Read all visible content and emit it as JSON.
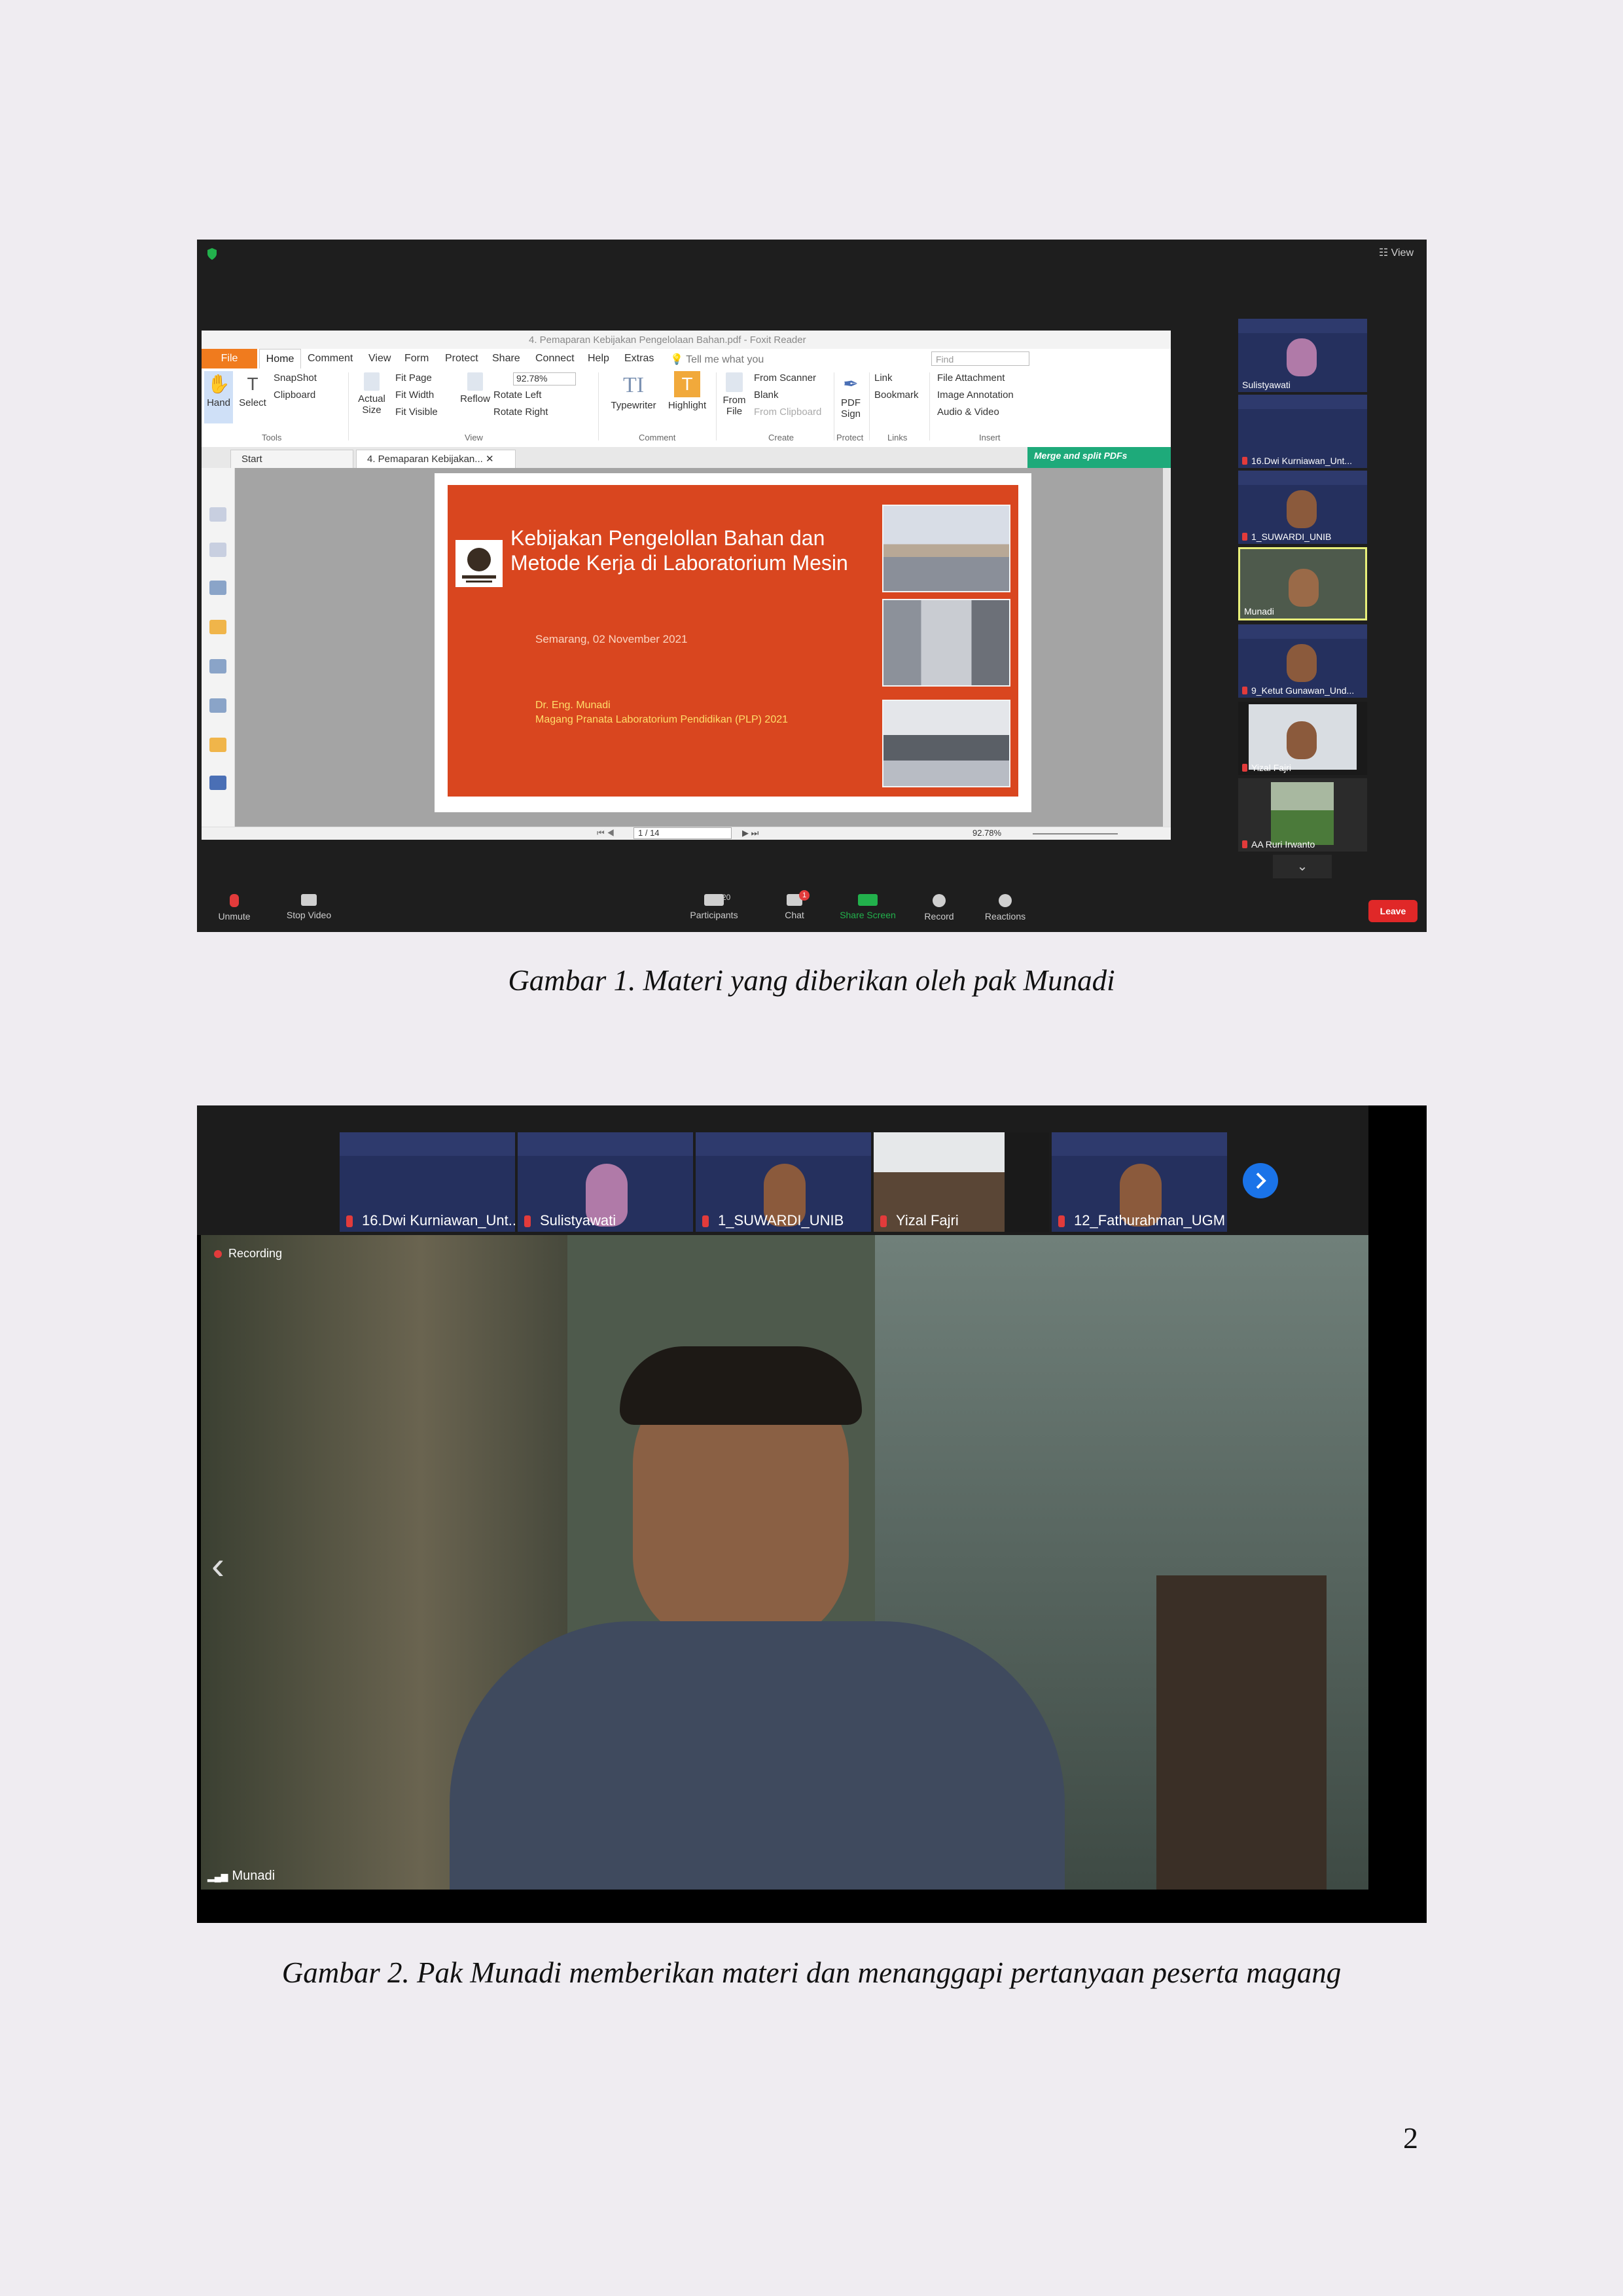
{
  "figure1": {
    "top_right_label": "View",
    "foxit": {
      "window_title": "4. Pemaparan Kebijakan Pengelolaan Bahan.pdf - Foxit Reader",
      "menu": [
        "File",
        "Home",
        "Comment",
        "View",
        "Form",
        "Protect",
        "Share",
        "Connect",
        "Help",
        "Extras"
      ],
      "tell_me": "Tell me what you",
      "find_placeholder": "Find",
      "ribbon": {
        "hand": "Hand",
        "select": "Select",
        "snapshot": "SnapShot",
        "clipboard": "Clipboard",
        "actual_size": "Actual Size",
        "fit_page": "Fit Page",
        "fit_width": "Fit Width",
        "fit_visible": "Fit Visible",
        "reflow": "Reflow",
        "zoom": "92.78%",
        "rotate_left": "Rotate Left",
        "rotate_right": "Rotate Right",
        "typewriter": "Typewriter",
        "highlight": "Highlight",
        "from_file": "From File",
        "from_scanner": "From Scanner",
        "blank": "Blank",
        "from_clipboard": "From Clipboard",
        "pdf_sign": "PDF Sign",
        "link": "Link",
        "bookmark": "Bookmark",
        "file_attachment": "File Attachment",
        "image_annotation": "Image Annotation",
        "audio_video": "Audio & Video",
        "groups": [
          "Tools",
          "View",
          "Comment",
          "Create",
          "Protect",
          "Links",
          "Insert"
        ]
      },
      "tabs": [
        "Start",
        "4. Pemaparan Kebijakan..."
      ],
      "merge_banner": "Merge and split PDFs",
      "slide": {
        "title_line1": "Kebijakan Pengelollan Bahan dan",
        "title_line2": "Metode Kerja di Laboratorium Mesin",
        "date": "Semarang, 02 November 2021",
        "author": "Dr. Eng. Munadi",
        "role": "Magang Pranata Laboratorium Pendidikan (PLP) 2021"
      },
      "status": {
        "page": "1 / 14",
        "zoom": "92.78%"
      }
    },
    "participants": [
      "Sulistyawati",
      "16.Dwi Kurniawan_Unt...",
      "1_SUWARDI_UNIB",
      "Munadi",
      "9_Ketut Gunawan_Und...",
      "Yizal Fajri",
      "AA Ruri Irwanto"
    ],
    "controls": {
      "unmute": "Unmute",
      "stop_video": "Stop Video",
      "participants_label": "Participants",
      "participants_count": "20",
      "chat": "Chat",
      "chat_badge": "1",
      "share_screen": "Share Screen",
      "record": "Record",
      "reactions": "Reactions",
      "leave": "Leave"
    }
  },
  "caption1": "Gambar 1. Materi yang diberikan oleh pak Munadi",
  "figure2": {
    "strip": [
      "16.Dwi Kurniawan_Unt...",
      "Sulistyawati",
      "1_SUWARDI_UNIB",
      "Yizal Fajri",
      "12_Fathurahman_UGM"
    ],
    "recording": "Recording",
    "speaker": "Munadi"
  },
  "caption2": "Gambar 2. Pak Munadi memberikan materi dan menanggapi pertanyaan peserta magang",
  "page_number": "2",
  "colors": {
    "zoom_dark": "#1e1e1e",
    "foxit_orange": "#f07b1e",
    "slide_red": "#d9461f",
    "leave_red": "#e02828",
    "share_green": "#22b14c",
    "active_speaker": "#e8f07a"
  }
}
